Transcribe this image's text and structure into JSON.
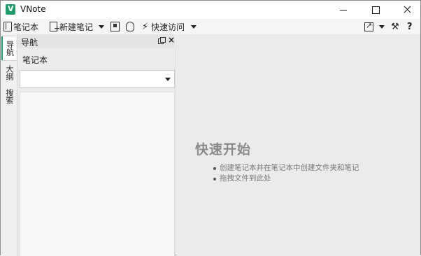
{
  "window": {
    "title": "VNote"
  },
  "toolbar": {
    "notebook_label": "笔记本",
    "new_note_label": "新建笔记",
    "quick_access_label": "快速访问",
    "help_label": "?"
  },
  "tabs": [
    {
      "label": "导航"
    },
    {
      "label": "大纲"
    },
    {
      "label": "搜索"
    }
  ],
  "nav_panel": {
    "title": "导航",
    "close_label": "×",
    "notebook_label": "笔记本",
    "notebook_select_value": ""
  },
  "quick_start": {
    "title": "快速开始",
    "items": [
      "创建笔记本并在笔记本中创建文件夹和笔记",
      "拖拽文件到此处"
    ]
  },
  "colors": {
    "accent": "#1f9a6b"
  }
}
